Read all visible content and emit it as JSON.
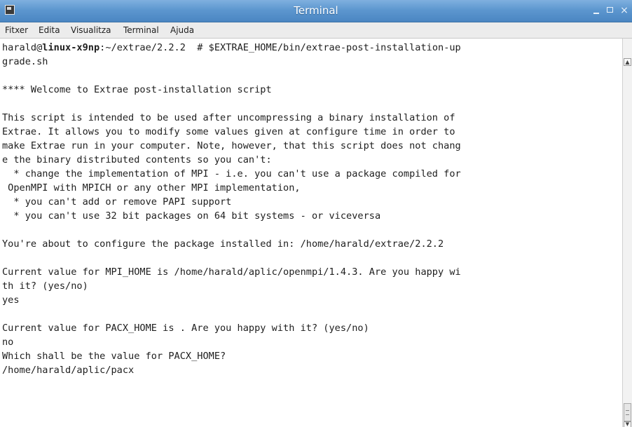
{
  "window": {
    "title": "Terminal",
    "icons": {
      "app": "terminal-icon",
      "minimize": "minimize-icon",
      "maximize": "maximize-icon",
      "close": "close-icon"
    },
    "close_glyph": "×",
    "titlebar_color": "#5d97cf"
  },
  "menubar": {
    "items": [
      "Fitxer",
      "Edita",
      "Visualitza",
      "Terminal",
      "Ajuda"
    ]
  },
  "terminal": {
    "prompt": {
      "user": "harald@",
      "host": "linux-x9np",
      "path": ":~/extrae/2.2.2",
      "command": "  # $EXTRAE_HOME/bin/extrae-post-installation-up"
    },
    "lines": [
      "grade.sh",
      "",
      "**** Welcome to Extrae post-installation script",
      "",
      "This script is intended to be used after uncompressing a binary installation of",
      "Extrae. It allows you to modify some values given at configure time in order to",
      "make Extrae run in your computer. Note, however, that this script does not chang",
      "e the binary distributed contents so you can't:",
      "  * change the implementation of MPI - i.e. you can't use a package compiled for",
      " OpenMPI with MPICH or any other MPI implementation,",
      "  * you can't add or remove PAPI support",
      "  * you can't use 32 bit packages on 64 bit systems - or viceversa",
      "",
      "You're about to configure the package installed in: /home/harald/extrae/2.2.2",
      "",
      "Current value for MPI_HOME is /home/harald/aplic/openmpi/1.4.3. Are you happy wi",
      "th it? (yes/no)",
      "yes",
      "",
      "Current value for PACX_HOME is . Are you happy with it? (yes/no)",
      "no",
      "Which shall be the value for PACX_HOME?",
      "/home/harald/aplic/pacx"
    ],
    "text_color": "#202020",
    "background": "#ffffff"
  },
  "scrollbar": {
    "up_glyph": "▲",
    "down_glyph": "▼",
    "position": 1.0
  }
}
